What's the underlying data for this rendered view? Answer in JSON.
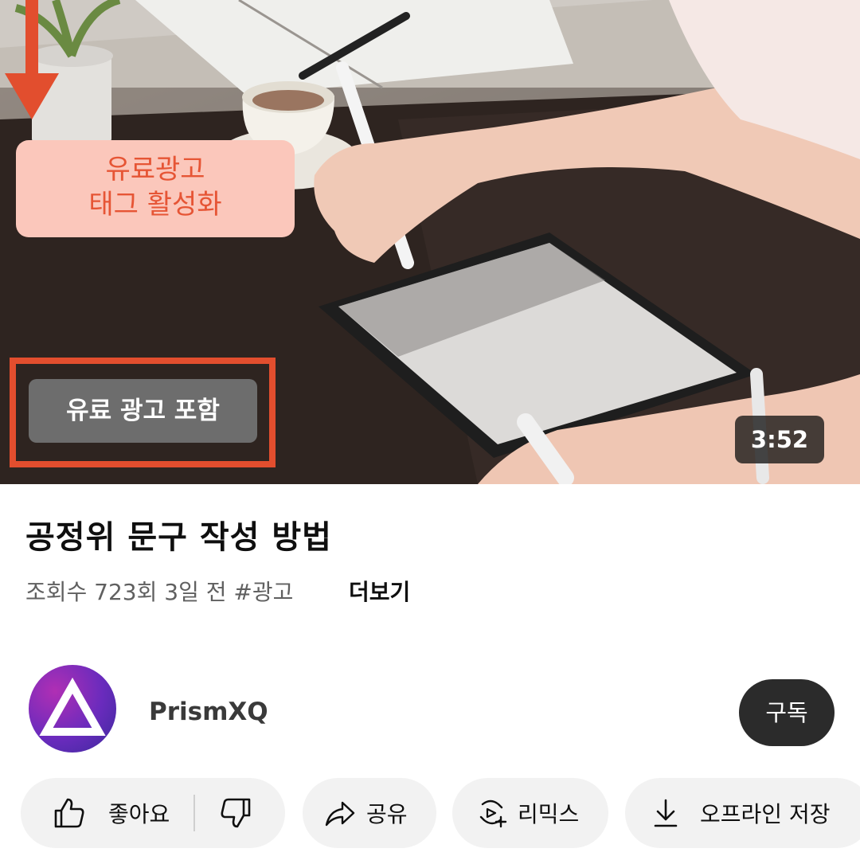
{
  "video": {
    "callout_line1": "유료광고",
    "callout_line2": "태그 활성화",
    "paid_badge": "유료 광고 포함",
    "duration": "3:52"
  },
  "info": {
    "title": "공정위 문구 작성 방법",
    "meta": "조회수 723회 3일 전 #광고",
    "more_label": "더보기"
  },
  "channel": {
    "name": "PrismXQ",
    "subscribe_label": "구독"
  },
  "actions": {
    "like_label": "좋아요",
    "share_label": "공유",
    "remix_label": "리믹스",
    "offline_label": "오프라인 저장"
  },
  "colors": {
    "annotation_red": "#e24e2e",
    "callout_bg": "#fbc7bb",
    "callout_text": "#e65535"
  }
}
